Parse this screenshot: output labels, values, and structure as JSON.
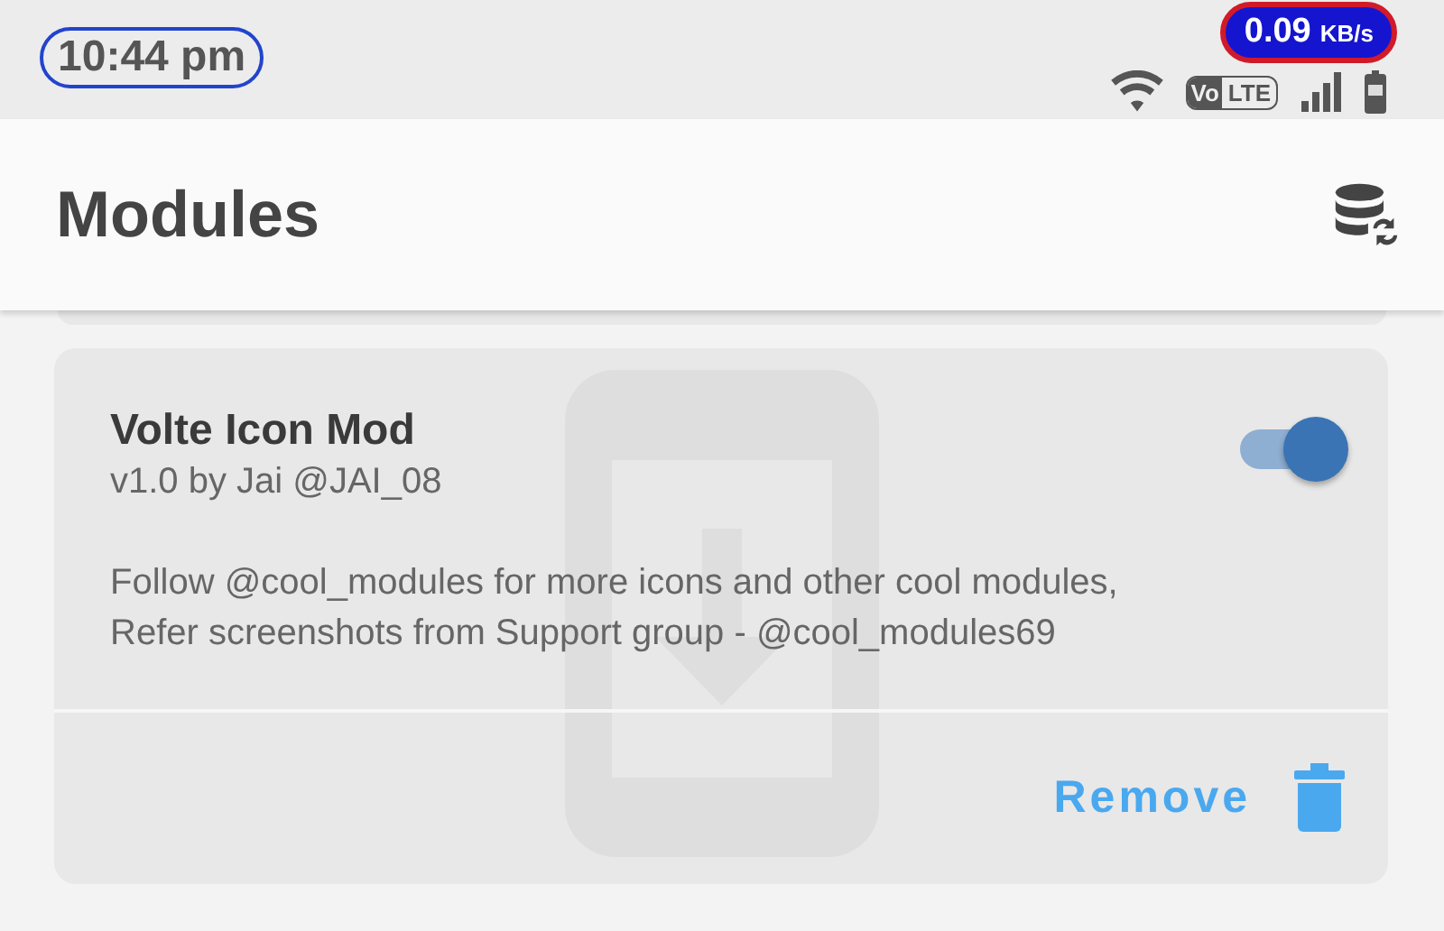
{
  "status_bar": {
    "time": "10:44 pm",
    "speed_value": "0.09",
    "speed_unit": "KB/s",
    "volte_badge": {
      "left": "Vo",
      "right": "LTE"
    }
  },
  "app_bar": {
    "title": "Modules"
  },
  "modules": [
    {
      "name": "Volte Icon Mod",
      "version": "v1.0 by Jai @JAI_08",
      "description": "Follow @cool_modules for more icons and other cool modules,\nRefer screenshots from Support group - @cool_modules69",
      "enabled": true,
      "action": "Remove"
    }
  ]
}
